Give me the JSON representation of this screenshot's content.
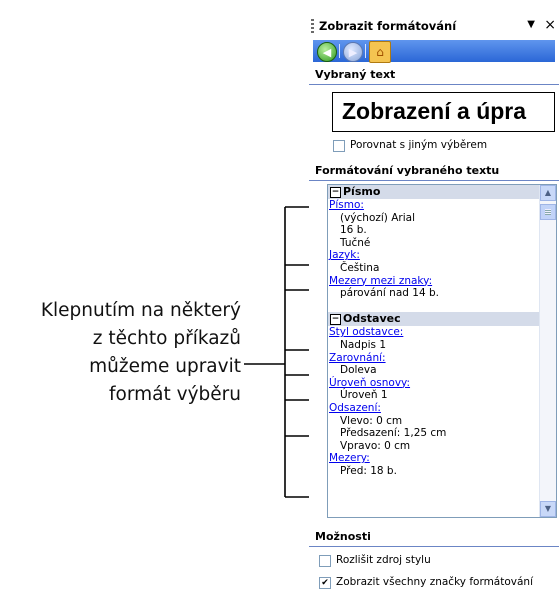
{
  "callout": {
    "lines": [
      "Klepnutím na některý",
      "z těchto příkazů",
      "můžeme upravit",
      "formát výběru"
    ]
  },
  "pane": {
    "title": "Zobrazit formátování",
    "dropdown_glyph": "▼",
    "close_glyph": "×",
    "nav": {
      "back_icon": "back-arrow-icon",
      "forward_icon": "forward-arrow-icon",
      "home_icon": "home-icon"
    },
    "selected_section": "Vybraný text",
    "preview_text": "Zobrazení a úpra",
    "compare_label": "Porovnat s jiným výběrem",
    "compare_checked": false,
    "formatting_section": "Formátování vybraného textu",
    "font_group": {
      "header": "Písmo",
      "collapse_glyph": "−",
      "font_link": "Písmo:",
      "font_values": [
        "(výchozí) Arial",
        "16 b.",
        "Tučné"
      ],
      "language_link": "Jazyk:",
      "language_value": "Čeština",
      "spacing_link": "Mezery mezi znaky:",
      "spacing_value": "párování nad 14 b."
    },
    "paragraph_group": {
      "header": "Odstavec",
      "collapse_glyph": "−",
      "style_link": "Styl odstavce:",
      "style_value": "Nadpis 1",
      "align_link": "Zarovnání:",
      "align_value": "Doleva",
      "outline_link": "Úroveň osnovy:",
      "outline_value": "Úroveň 1",
      "indent_link": "Odsazení:",
      "indent_values": [
        "Vlevo:  0 cm",
        "Předsazení:  1,25 cm",
        "Vpravo:  0 cm"
      ],
      "spacing_link": "Mezery:",
      "spacing_value": "Před:  18 b."
    },
    "options_section": "Možnosti",
    "option1_label": "Rozlišit zdroj stylu",
    "option1_checked": false,
    "option2_label": "Zobrazit všechny značky formátování",
    "option2_checked": true,
    "check_mark": "✔",
    "scroll_up_glyph": "▲",
    "scroll_down_glyph": "▼"
  }
}
